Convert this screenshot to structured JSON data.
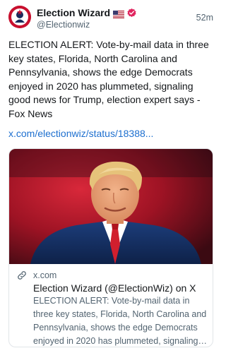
{
  "post": {
    "author": {
      "display_name": "Election Wizard",
      "handle": "@Electionwiz",
      "flag_icon": "us-flag-icon",
      "verified_icon": "verified-badge-icon",
      "verified_color": "#e0245e"
    },
    "timestamp": "52m",
    "text": "ELECTION ALERT: Vote-by-mail data in three key states, Florida, North Carolina and Pennsylvania, shows the edge Democrats enjoyed in 2020 has plummeted, signaling good news for Trump, election expert says - Fox News",
    "link_text": "x.com/electionwiz/status/18388...",
    "link_color": "#1d6fcf"
  },
  "card": {
    "link_icon": "link-icon",
    "domain": "x.com",
    "title": "Election Wizard (@ElectionWiz) on X",
    "description": "ELECTION ALERT: Vote-by-mail data in three key states, Florida, North Carolina and Pennsylvania, shows the edge Democrats enjoyed in 2020 has plummeted, signaling g..."
  },
  "colors": {
    "text_primary": "#14171a",
    "text_secondary": "#536471",
    "avatar_bg": "#c8102e",
    "card_border": "#e1e5e8"
  }
}
